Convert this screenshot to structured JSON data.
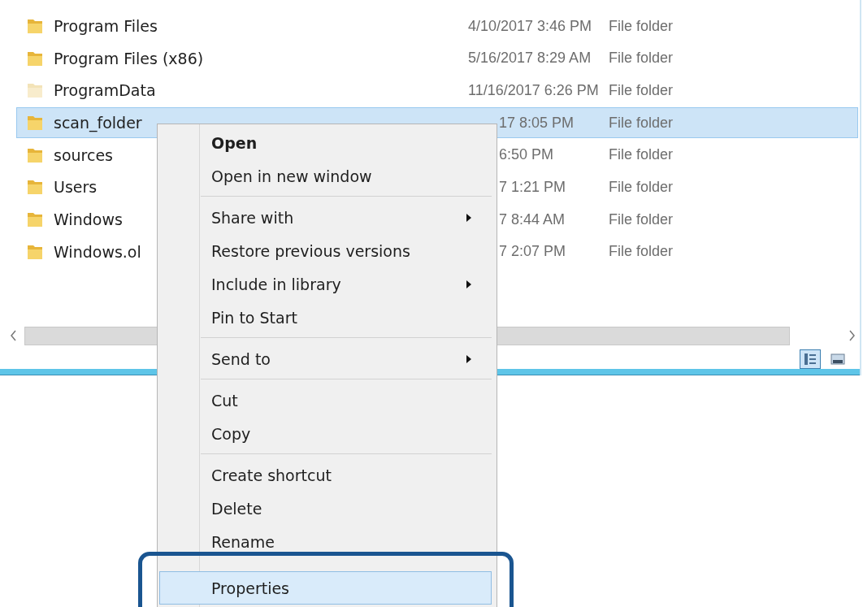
{
  "files": [
    {
      "name": "Program Files",
      "date": "4/10/2017 3:46 PM",
      "type": "File folder",
      "selected": false,
      "hidden": false
    },
    {
      "name": "Program Files (x86)",
      "date": "5/16/2017 8:29 AM",
      "type": "File folder",
      "selected": false,
      "hidden": false
    },
    {
      "name": "ProgramData",
      "date": "11/16/2017 6:26 PM",
      "type": "File folder",
      "selected": false,
      "hidden": true
    },
    {
      "name": "scan_folder",
      "date": "17 8:05 PM",
      "type": "File folder",
      "selected": true,
      "hidden": false
    },
    {
      "name": "sources",
      "date": "6:50 PM",
      "type": "File folder",
      "selected": false,
      "hidden": false
    },
    {
      "name": "Users",
      "date": "7 1:21 PM",
      "type": "File folder",
      "selected": false,
      "hidden": false
    },
    {
      "name": "Windows",
      "date": "7 8:44 AM",
      "type": "File folder",
      "selected": false,
      "hidden": false
    },
    {
      "name": "Windows.ol",
      "date": "7 2:07 PM",
      "type": "File folder",
      "selected": false,
      "hidden": false
    }
  ],
  "view_buttons": [
    {
      "kind": "details",
      "selected": true
    },
    {
      "kind": "preview",
      "selected": false
    }
  ],
  "context_menu": {
    "groups": [
      [
        {
          "label": "Open",
          "default": true,
          "submenu": false,
          "selected": false
        },
        {
          "label": "Open in new window",
          "default": false,
          "submenu": false,
          "selected": false
        }
      ],
      [
        {
          "label": "Share with",
          "default": false,
          "submenu": true,
          "selected": false
        },
        {
          "label": "Restore previous versions",
          "default": false,
          "submenu": false,
          "selected": false
        },
        {
          "label": "Include in library",
          "default": false,
          "submenu": true,
          "selected": false
        },
        {
          "label": "Pin to Start",
          "default": false,
          "submenu": false,
          "selected": false
        }
      ],
      [
        {
          "label": "Send to",
          "default": false,
          "submenu": true,
          "selected": false
        }
      ],
      [
        {
          "label": "Cut",
          "default": false,
          "submenu": false,
          "selected": false
        },
        {
          "label": "Copy",
          "default": false,
          "submenu": false,
          "selected": false
        }
      ],
      [
        {
          "label": "Create shortcut",
          "default": false,
          "submenu": false,
          "selected": false
        },
        {
          "label": "Delete",
          "default": false,
          "submenu": false,
          "selected": false
        },
        {
          "label": "Rename",
          "default": false,
          "submenu": false,
          "selected": false
        }
      ],
      [
        {
          "label": "Properties",
          "default": false,
          "submenu": false,
          "selected": true
        }
      ]
    ]
  }
}
